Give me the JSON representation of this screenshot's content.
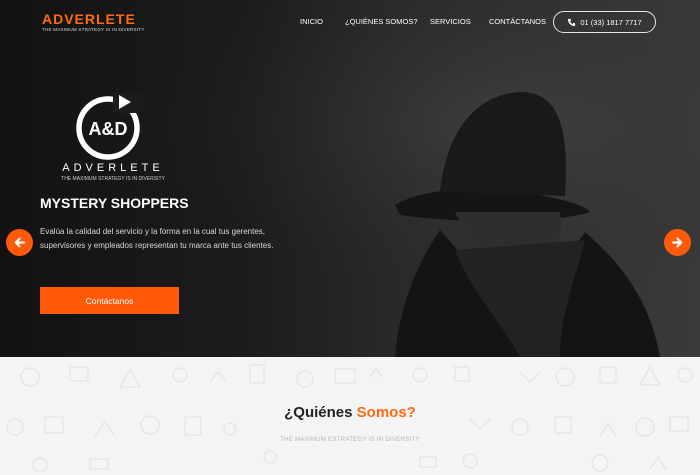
{
  "brand": {
    "name": "ADVERLETE",
    "tagline": "THE MAXIMUM STRATEGY IS IN DIVERSITY"
  },
  "nav": {
    "items": [
      {
        "label": "INICIO"
      },
      {
        "label": "¿QUIÉNES SOMOS?"
      },
      {
        "label": "SERVICIOS"
      },
      {
        "label": "CONTÁCTANOS"
      }
    ],
    "phone": "01 (33) 1817 7717"
  },
  "hero": {
    "logo_letters": "A&D",
    "logo_word": "ADVERLETE",
    "logo_tagline": "THE MAXIMUM STRATEGY IS IN DIVERSITY",
    "title": "MYSTERY SHOPPERS",
    "description": "Evalúa la calidad del servicio y la forma en la cual tus gerentes, supervisores y empleados representan tu marca ante tus clientes.",
    "cta_label": "Contáctanos"
  },
  "about": {
    "title_main": "¿Quiénes ",
    "title_accent": "Somos?",
    "subtitle": "THE MAXIMUM ESTRATEGY IS IN DIVERSITY"
  },
  "colors": {
    "accent": "#ff5a0a",
    "hero_bg": "#1a1a1a",
    "section_bg": "#f4f4f4"
  },
  "icons": {
    "phone": "phone-icon",
    "prev": "chevron-left-icon",
    "next": "chevron-right-icon"
  }
}
